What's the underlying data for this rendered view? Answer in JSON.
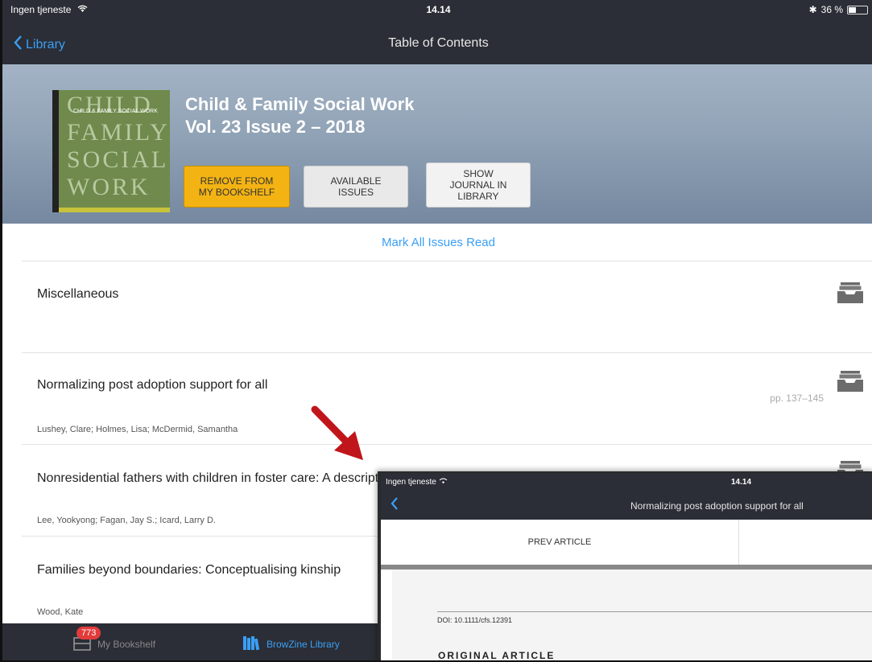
{
  "status": {
    "carrier": "Ingen tjeneste",
    "time": "14.14",
    "battery": "36 %"
  },
  "nav": {
    "back_label": "Library",
    "title": "Table of Contents"
  },
  "journal": {
    "title_line1": "Child & Family Social Work",
    "title_line2": "Vol. 23 Issue 2 – 2018",
    "cover_lines": [
      "CHILD",
      "FAMILY",
      "SOCIAL",
      "WORK"
    ],
    "cover_small": "CHILD & FAMILY SOCIAL WORK"
  },
  "buttons": {
    "remove_line1": "REMOVE FROM",
    "remove_line2": "MY BOOKSHELF",
    "available_line1": "AVAILABLE",
    "available_line2": "ISSUES",
    "show_line1": "SHOW",
    "show_line2": "JOURNAL IN",
    "show_line3": "LIBRARY"
  },
  "mark_all": "Mark All Issues Read",
  "articles": [
    {
      "title": "Miscellaneous",
      "authors": "",
      "pages": ""
    },
    {
      "title": "Normalizing post adoption support for all",
      "authors": "Lushey, Clare; Holmes, Lisa; McDermid, Samantha",
      "pages": "pp. 137–145"
    },
    {
      "title": "Nonresidential fathers with children in foster care: A descriptive analysis in the United States",
      "authors": "Lee, Yookyong; Fagan, Jay S.; Icard, Larry D.",
      "pages": ""
    },
    {
      "title": "Families beyond boundaries: Conceptualising kinship",
      "authors": "Wood, Kate",
      "pages": ""
    }
  ],
  "tabbar": {
    "bookshelf_label": "My Bookshelf",
    "bookshelf_badge": "773",
    "library_label": "BrowZine Library"
  },
  "overlay": {
    "carrier": "Ingen tjeneste",
    "time": "14.14",
    "title": "Normalizing post adoption support for all",
    "prev_label": "PREV ARTICLE",
    "doi": "DOI: 10.1111/cfs.12391",
    "original_article": "ORIGINAL ARTICLE"
  },
  "colors": {
    "accent_blue": "#3a9ff5",
    "bar_dark": "#2b2e36",
    "button_yellow": "#f3b313",
    "arrow_red": "#c0161b",
    "badge_red": "#e33b3b"
  }
}
